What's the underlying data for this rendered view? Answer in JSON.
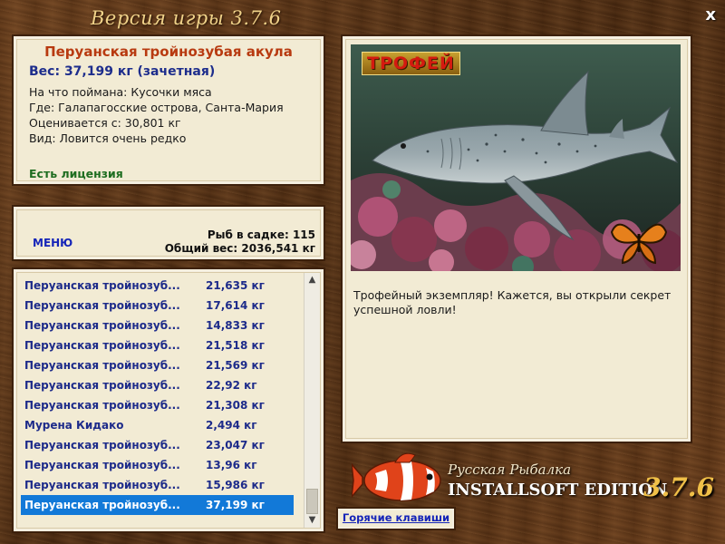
{
  "window": {
    "title": "Версия игры 3.7.6",
    "close_symbol": "x"
  },
  "fish": {
    "name": "Перуанская тройнозубая акула",
    "weight": "Вес: 37,199 кг (зачетная)",
    "lines": [
      "На что поймана: Кусочки мяса",
      "Где: Галапагосские острова, Санта-Мария",
      "Оценивается с: 30,801 кг",
      "Вид: Ловится очень редко"
    ],
    "license": "Есть лицензия"
  },
  "stats": {
    "menu_label": "МЕНЮ",
    "fish_in_keepnet": "Рыб в садке: 115",
    "total_weight": "Общий вес: 2036,541 кг"
  },
  "catch_list": [
    {
      "name": "Перуанская тройнозуб...",
      "weight": "21,635 кг",
      "selected": false
    },
    {
      "name": "Перуанская тройнозуб...",
      "weight": "17,614 кг",
      "selected": false
    },
    {
      "name": "Перуанская тройнозуб...",
      "weight": "14,833 кг",
      "selected": false
    },
    {
      "name": "Перуанская тройнозуб...",
      "weight": "21,518 кг",
      "selected": false
    },
    {
      "name": "Перуанская тройнозуб...",
      "weight": "21,569 кг",
      "selected": false
    },
    {
      "name": "Перуанская тройнозуб...",
      "weight": "22,92 кг",
      "selected": false
    },
    {
      "name": "Перуанская тройнозуб...",
      "weight": "21,308 кг",
      "selected": false
    },
    {
      "name": "Мурена Кидако",
      "weight": "2,494 кг",
      "selected": false
    },
    {
      "name": "Перуанская тройнозуб...",
      "weight": "23,047 кг",
      "selected": false
    },
    {
      "name": "Перуанская тройнозуб...",
      "weight": "13,96 кг",
      "selected": false
    },
    {
      "name": "Перуанская тройнозуб...",
      "weight": "15,986 кг",
      "selected": false
    },
    {
      "name": "Перуанская тройнозуб...",
      "weight": "37,199 кг",
      "selected": true
    }
  ],
  "photo": {
    "badge": "ТРОФЕЙ",
    "description": "Трофейный экземпляр! Кажется, вы открыли секрет успешной ловли!"
  },
  "hotkeys_label": "Горячие клавиши",
  "logo": {
    "subtitle": "Русская Рыбалка",
    "edition": "INSTALLSOFT EDITION",
    "version": "3.7.6"
  },
  "colors": {
    "wood": "#5a3416",
    "panel": "#f2ebd4",
    "fish_name": "#b83a10",
    "link_blue": "#1524b8",
    "list_text": "#1d2b8a",
    "selection": "#1279d8",
    "license_green": "#1e6d20"
  }
}
